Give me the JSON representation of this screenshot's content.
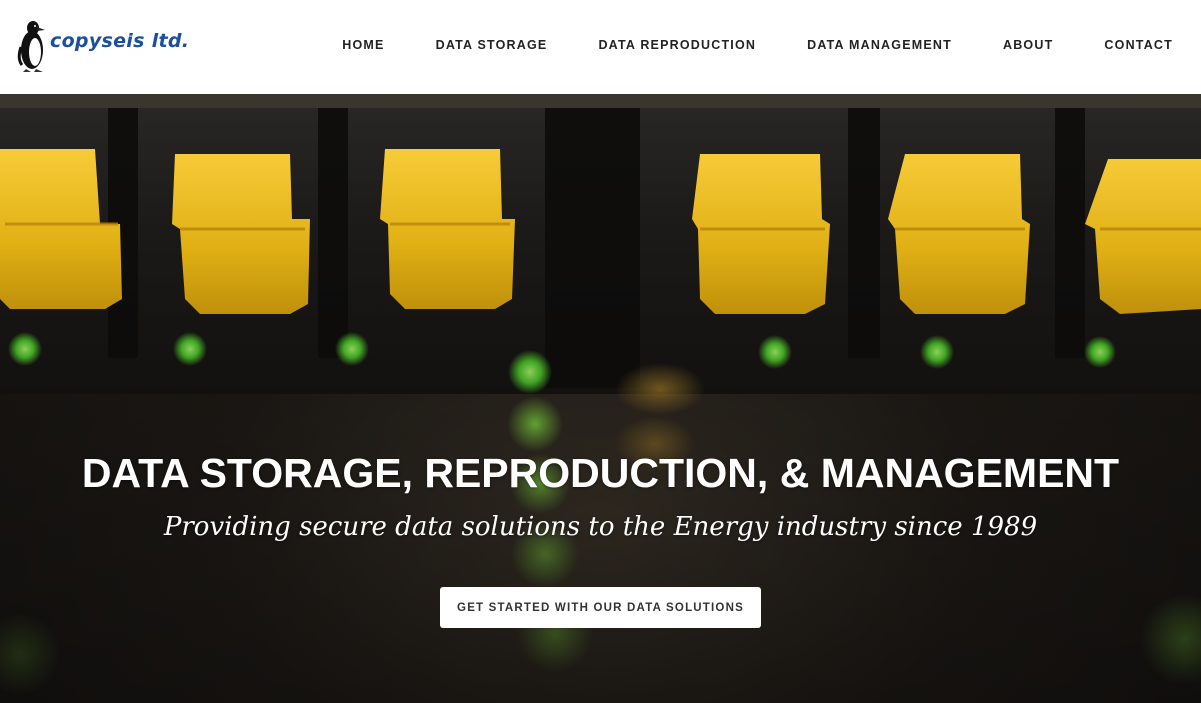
{
  "brand": {
    "logo_text": "copyseis ltd.",
    "logo_icon": "penguin-icon",
    "logo_color": "#1c4f9c"
  },
  "nav": {
    "items": [
      {
        "label": "HOME"
      },
      {
        "label": "DATA STORAGE"
      },
      {
        "label": "DATA REPRODUCTION"
      },
      {
        "label": "DATA MANAGEMENT"
      },
      {
        "label": "ABOUT"
      },
      {
        "label": "CONTACT"
      }
    ]
  },
  "hero": {
    "title": "DATA STORAGE, REPRODUCTION, & MANAGEMENT",
    "subtitle": "Providing secure data solutions to the Energy industry since 1989",
    "cta_label": "GET STARTED WITH OUR DATA SOLUTIONS",
    "background_image": "server-ethernet-ports-photo",
    "accent_colors": {
      "cable_yellow": "#f6c21c",
      "led_green": "#5fd43a"
    }
  }
}
